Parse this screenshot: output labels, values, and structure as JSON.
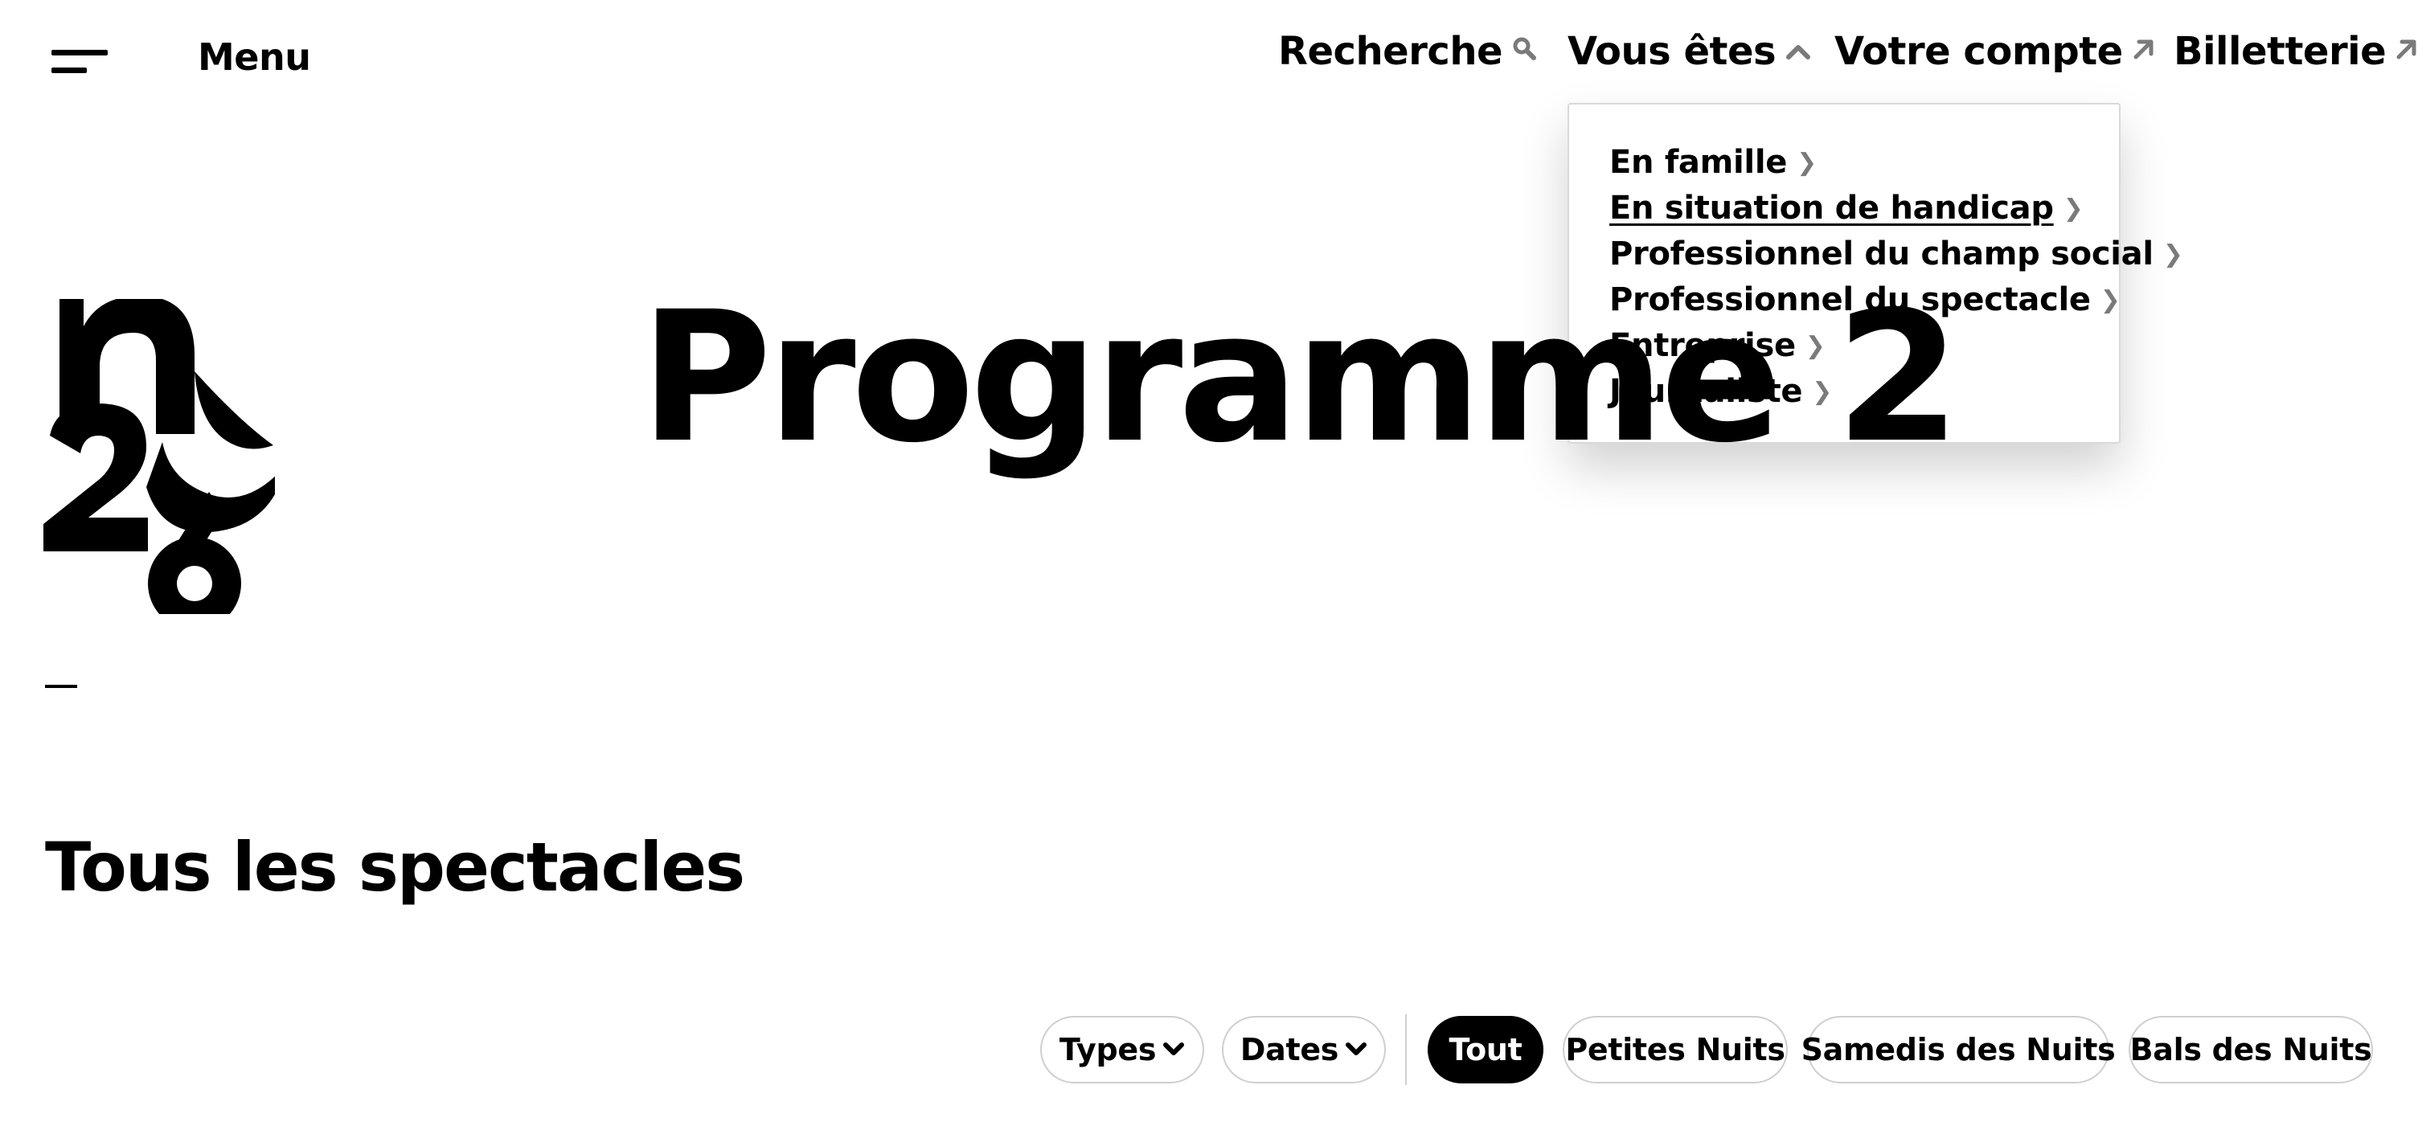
{
  "header": {
    "menu_label": "Menu",
    "nav": {
      "search": {
        "label": "Recherche",
        "icon": "search-icon"
      },
      "vous": {
        "label": "Vous êtes",
        "icon": "chevron-up-icon"
      },
      "compte": {
        "label": "Votre compte",
        "icon": "external-arrow-icon"
      },
      "billetterie": {
        "label": "Billetterie",
        "icon": "external-arrow-icon"
      }
    }
  },
  "dropdown": {
    "items": [
      {
        "label": "En famille"
      },
      {
        "label": "En situation de handicap",
        "hovered": true
      },
      {
        "label": "Professionnel du champ social"
      },
      {
        "label": "Professionnel du spectacle"
      },
      {
        "label": "Entreprise"
      },
      {
        "label": "Journaliste"
      }
    ]
  },
  "logo": {
    "text": "n26"
  },
  "hero": {
    "title": "Programme 2"
  },
  "section": {
    "title": "Tous les spectacles"
  },
  "filters": {
    "types": "Types",
    "dates": "Dates",
    "chips": [
      {
        "label": "Tout",
        "active": true
      },
      {
        "label": "Petites Nuits",
        "active": false
      },
      {
        "label": "Samedis des Nuits",
        "active": false
      },
      {
        "label": "Bals des Nuits",
        "active": false
      }
    ]
  },
  "colors": {
    "text": "#000000",
    "background": "#ffffff",
    "icon_gray": "#7a7a7a",
    "border": "#cfcfcf"
  }
}
